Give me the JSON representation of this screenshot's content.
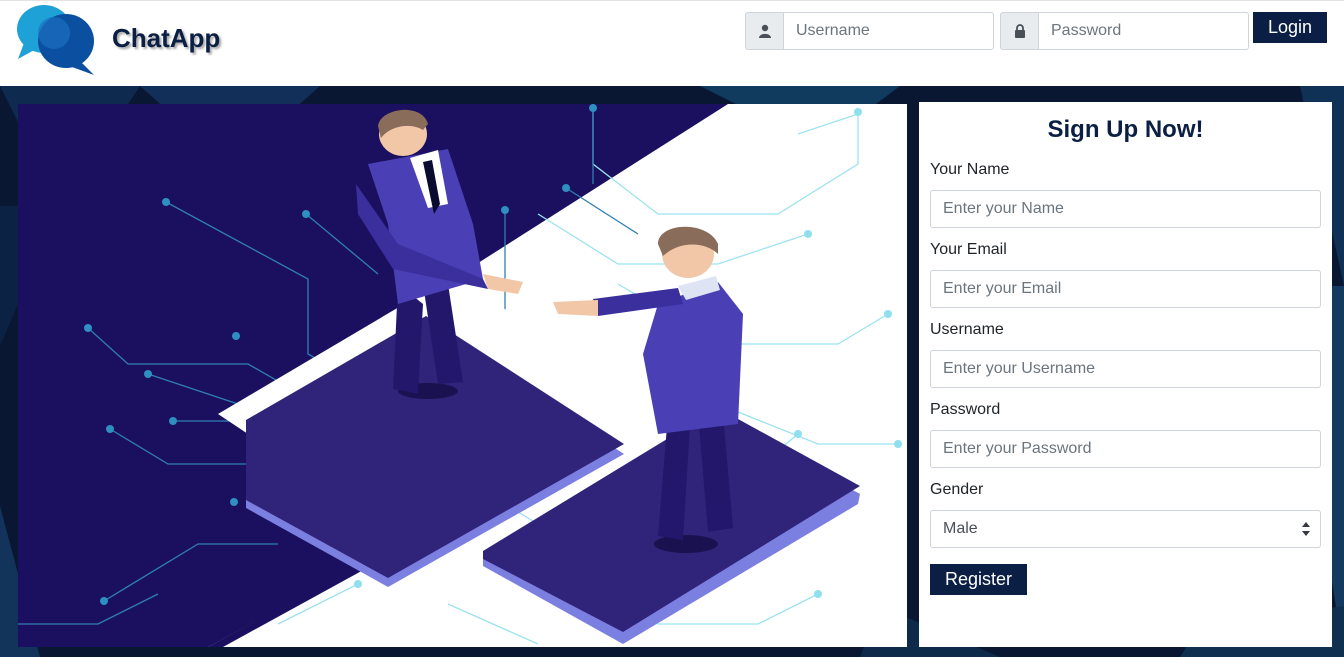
{
  "brand": {
    "name": "ChatApp"
  },
  "login": {
    "username_placeholder": "Username",
    "password_placeholder": "Password",
    "button_label": "Login"
  },
  "signup": {
    "title": "Sign Up Now!",
    "name": {
      "label": "Your Name",
      "placeholder": "Enter your Name"
    },
    "email": {
      "label": "Your Email",
      "placeholder": "Enter your Email"
    },
    "username": {
      "label": "Username",
      "placeholder": "Enter your Username"
    },
    "password": {
      "label": "Password",
      "placeholder": "Enter your Password"
    },
    "gender": {
      "label": "Gender",
      "selected": "Male"
    },
    "register_label": "Register"
  },
  "icons": {
    "logo": "chat-bubbles-logo",
    "username_addon": "user-icon",
    "password_addon": "lock-icon",
    "select_arrows": "sort-arrows-icon"
  },
  "colors": {
    "brand_navy": "#0b1f44",
    "hero_dark": "#0a1733",
    "illustration_indigo": "#1b1060",
    "logo_light": "#1da1d6",
    "logo_dark": "#0a4fa0"
  }
}
